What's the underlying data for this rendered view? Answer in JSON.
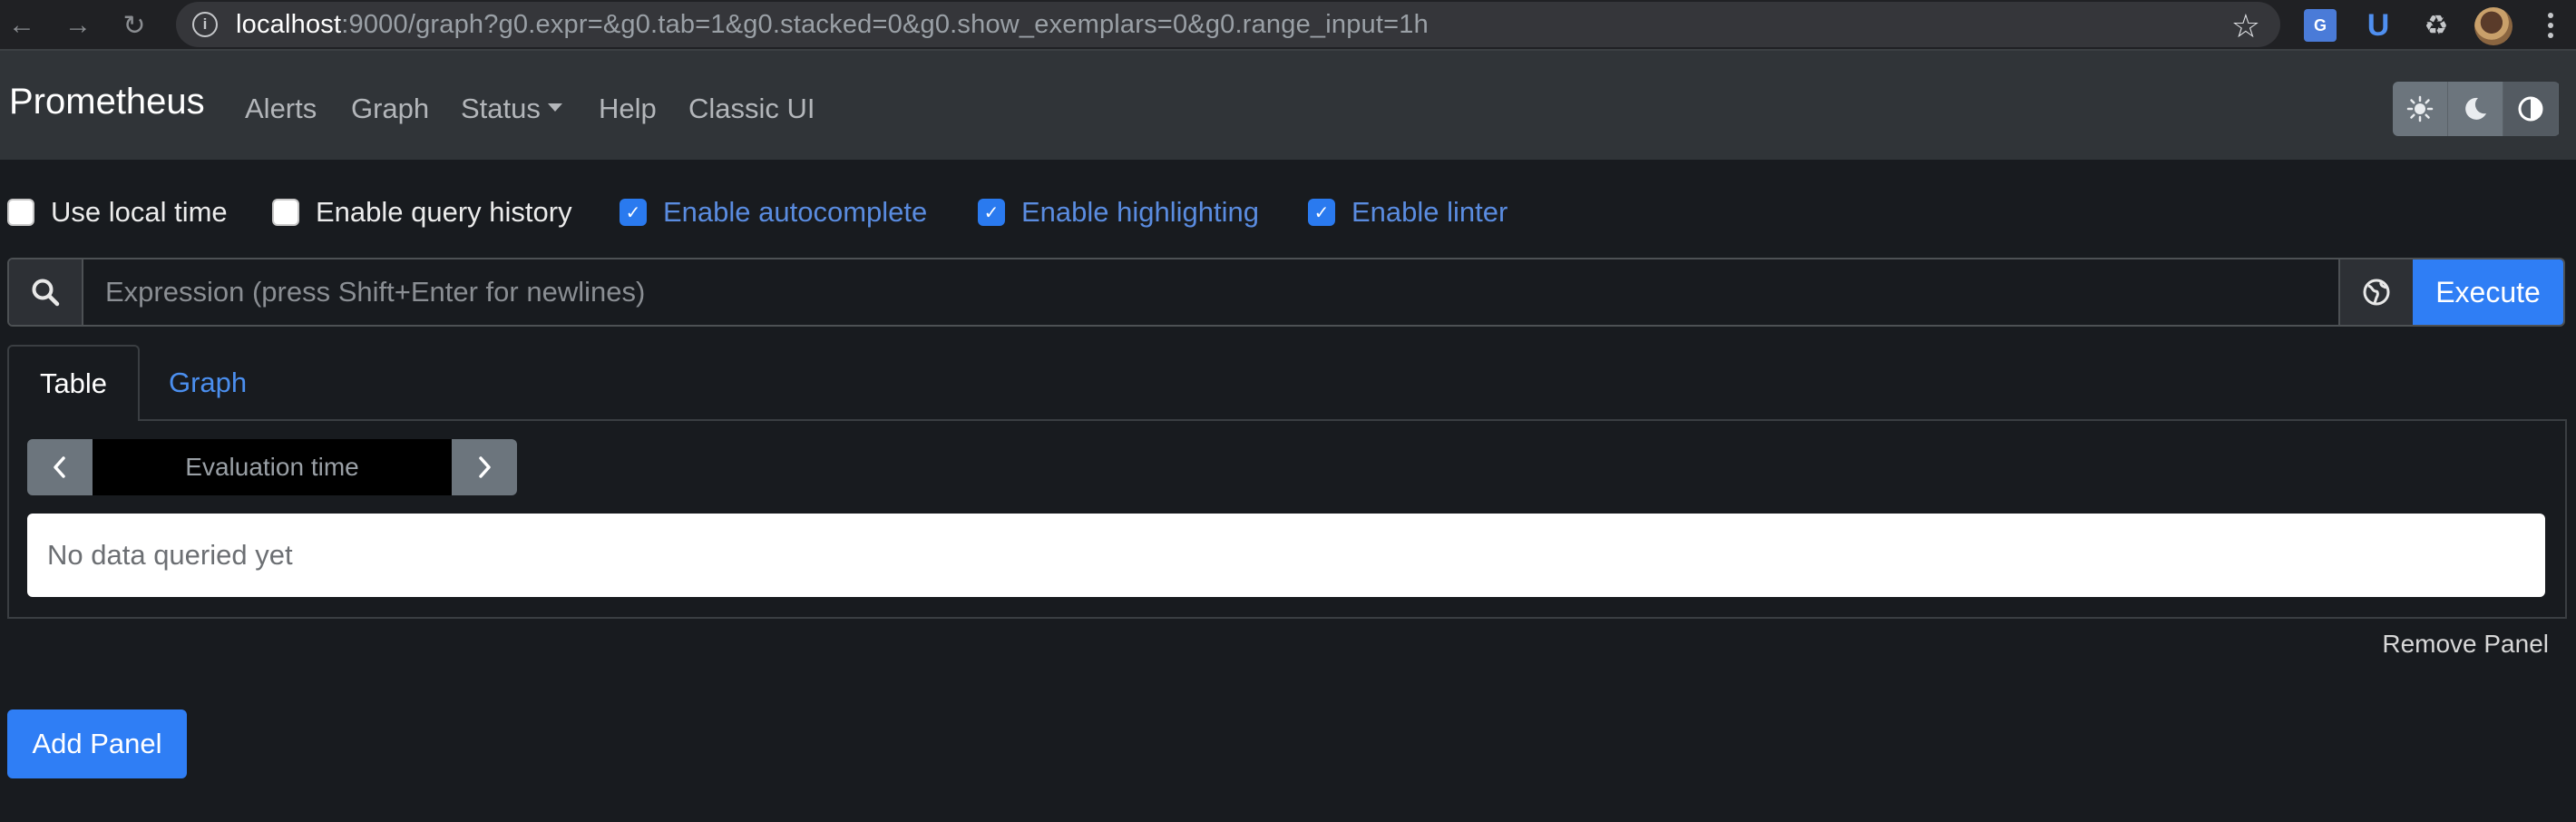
{
  "browser": {
    "url_host": "localhost",
    "url_rest": ":9000/graph?g0.expr=&g0.tab=1&g0.stacked=0&g0.show_exemplars=0&g0.range_input=1h"
  },
  "navbar": {
    "brand": "Prometheus",
    "links": [
      "Alerts",
      "Graph",
      "Status",
      "Help",
      "Classic UI"
    ]
  },
  "options": [
    {
      "label": "Use local time",
      "checked": false
    },
    {
      "label": "Enable query history",
      "checked": false
    },
    {
      "label": "Enable autocomplete",
      "checked": true
    },
    {
      "label": "Enable highlighting",
      "checked": true
    },
    {
      "label": "Enable linter",
      "checked": true
    }
  ],
  "expression": {
    "placeholder": "Expression (press Shift+Enter for newlines)",
    "value": "",
    "execute_label": "Execute"
  },
  "panel": {
    "tabs": [
      "Table",
      "Graph"
    ],
    "active_tab": "Table",
    "eval_time_placeholder": "Evaluation time",
    "no_data": "No data queried yet",
    "remove_label": "Remove Panel"
  },
  "add_panel_label": "Add Panel",
  "icons": {
    "back": "arrow-left-icon",
    "forward": "arrow-right-icon",
    "reload": "reload-icon",
    "star": "star-icon",
    "search": "search-icon",
    "globe": "globe-icon",
    "theme_light": "sun-icon",
    "theme_dark": "moon-icon",
    "theme_auto": "half-circle-icon"
  },
  "colors": {
    "accent": "#2f7ef5",
    "background": "#181b1f",
    "navbar": "#303438"
  }
}
